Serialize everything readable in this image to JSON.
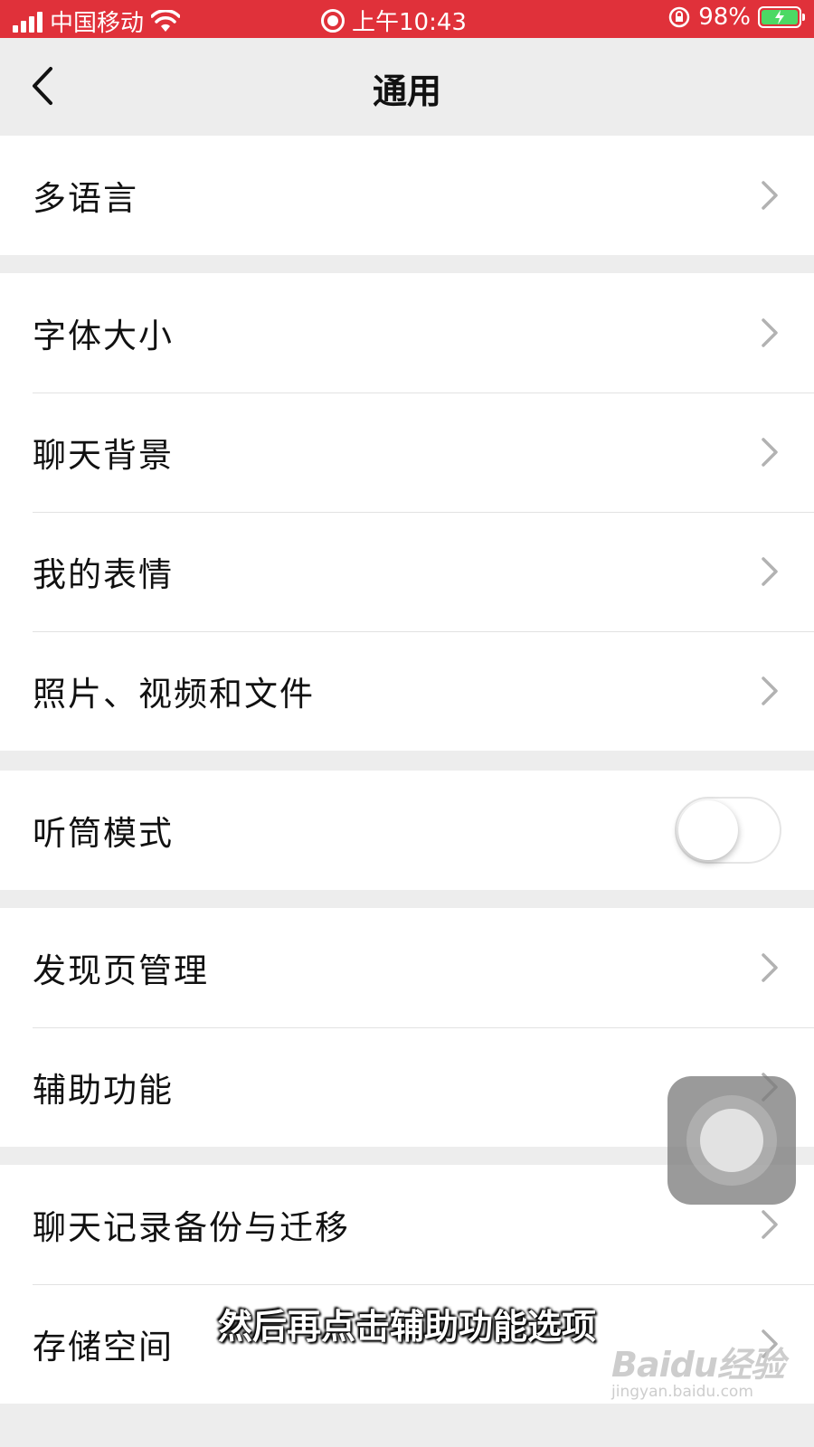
{
  "status_bar": {
    "carrier": "中国移动",
    "time": "上午10:43",
    "battery": "98%"
  },
  "nav": {
    "title": "通用"
  },
  "sections": {
    "lang": {
      "items": [
        {
          "label": "多语言"
        }
      ]
    },
    "display": {
      "items": [
        {
          "label": "字体大小"
        },
        {
          "label": "聊天背景"
        },
        {
          "label": "我的表情"
        },
        {
          "label": "照片、视频和文件"
        }
      ]
    },
    "earpiece": {
      "items": [
        {
          "label": "听筒模式",
          "toggle_on": false
        }
      ]
    },
    "features": {
      "items": [
        {
          "label": "发现页管理"
        },
        {
          "label": "辅助功能"
        }
      ]
    },
    "storage": {
      "items": [
        {
          "label": "聊天记录备份与迁移"
        },
        {
          "label": "存储空间"
        }
      ]
    }
  },
  "caption": "然后再点击辅助功能选项",
  "watermark": {
    "logo": "Baidu经验",
    "url": "jingyan.baidu.com"
  },
  "colors": {
    "status_bar_bg": "#e0313a",
    "page_bg": "#ededed"
  }
}
